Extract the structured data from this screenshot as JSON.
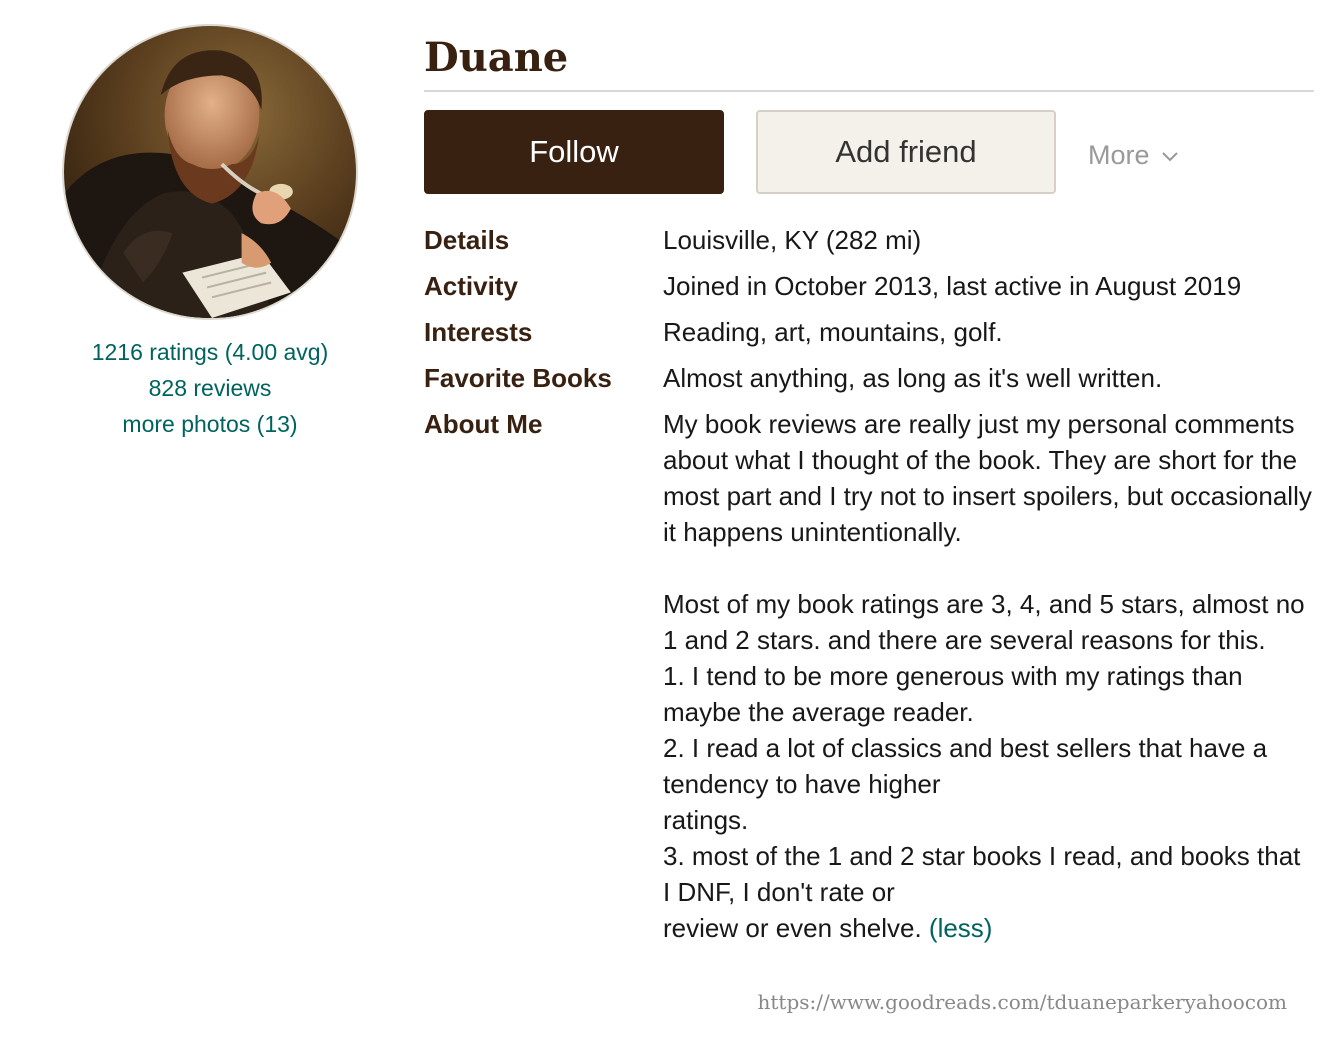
{
  "profile": {
    "name": "Duane",
    "avatar_icon": "portrait-avatar-icon",
    "stats": {
      "ratings": "1216 ratings (4.00 avg)",
      "reviews": "828 reviews",
      "photos": "more photos (13)"
    }
  },
  "actions": {
    "follow_label": "Follow",
    "add_friend_label": "Add friend",
    "more_label": "More",
    "more_icon": "chevron-down-icon"
  },
  "info": {
    "details": {
      "label": "Details",
      "value": "Louisville, KY (282 mi)"
    },
    "activity": {
      "label": "Activity",
      "value": "Joined in October 2013, last active in August 2019"
    },
    "interests": {
      "label": "Interests",
      "value": "Reading, art, mountains, golf."
    },
    "favorite_books": {
      "label": "Favorite Books",
      "value": "Almost anything, as long as it's well written."
    },
    "about": {
      "label": "About Me",
      "value": "My book reviews are really just my personal comments about what I thought of the book. They are short for the most part and I try not to insert spoilers, but occasionally it happens unintentionally.\n\nMost of my book ratings are 3, 4, and 5 stars, almost no 1 and 2 stars. and there are several reasons for this.\n1. I tend to be more generous with my ratings than maybe the average reader.\n2. I read a lot of classics and best sellers that have a tendency to have higher\nratings.\n3. most of the 1 and 2 star books I read, and books that I DNF, I don't rate or\nreview or even shelve. ",
      "less_label": "(less)"
    }
  },
  "footer": {
    "url": "https://www.goodreads.com/tduaneparkeryahoocom"
  },
  "colors": {
    "brand_brown": "#382110",
    "link_green": "#00635d",
    "button_beige": "#f4f1ea"
  }
}
